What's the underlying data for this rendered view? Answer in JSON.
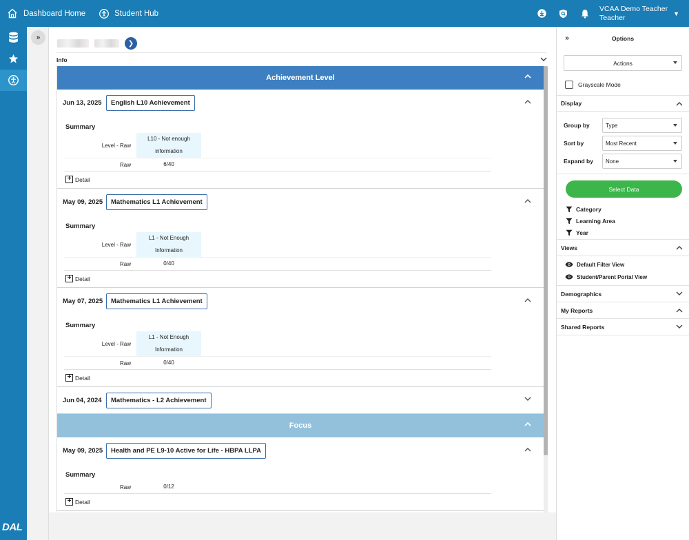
{
  "topbar": {
    "nav_home": "Dashboard Home",
    "nav_hub": "Student Hub",
    "user_name": "VCAA Demo Teacher",
    "user_role": "Teacher"
  },
  "sidebar": {
    "logo": "DAL"
  },
  "main": {
    "info_label": "Info",
    "groups": [
      {
        "label": "Achievement Level",
        "items": [
          {
            "date": "Jun 13, 2025",
            "title": "English L10 Achievement",
            "summary_label": "Summary",
            "rows": [
              {
                "label": "Level - Raw",
                "value": "L10 - Not enough information"
              },
              {
                "label": "Raw",
                "value": "6/40"
              }
            ],
            "detail_label": "Detail"
          },
          {
            "date": "May 09, 2025",
            "title": "Mathematics L1 Achievement",
            "summary_label": "Summary",
            "rows": [
              {
                "label": "Level - Raw",
                "value": "L1 - Not Enough Information"
              },
              {
                "label": "Raw",
                "value": "0/40"
              }
            ],
            "detail_label": "Detail"
          },
          {
            "date": "May 07, 2025",
            "title": "Mathematics L1 Achievement",
            "summary_label": "Summary",
            "rows": [
              {
                "label": "Level - Raw",
                "value": "L1 - Not Enough Information"
              },
              {
                "label": "Raw",
                "value": "0/40"
              }
            ],
            "detail_label": "Detail"
          },
          {
            "date": "Jun 04, 2024",
            "title": "Mathematics - L2 Achievement"
          }
        ]
      },
      {
        "label": "Focus",
        "items": [
          {
            "date": "May 09, 2025",
            "title": "Health and PE L9-10 Active for Life - HBPA LLPA",
            "summary_label": "Summary",
            "rows": [
              {
                "label": "Raw",
                "value": "0/12"
              }
            ],
            "detail_label": "Detail"
          }
        ]
      }
    ]
  },
  "options": {
    "title": "Options",
    "actions_label": "Actions",
    "grayscale_label": "Grayscale Mode",
    "display": {
      "title": "Display",
      "group_by_label": "Group by",
      "group_by_value": "Type",
      "sort_by_label": "Sort by",
      "sort_by_value": "Most Recent",
      "expand_by_label": "Expand by",
      "expand_by_value": "None"
    },
    "select_data_label": "Select Data",
    "filters": [
      "Category",
      "Learning Area",
      "Year"
    ],
    "views": {
      "title": "Views",
      "items": [
        "Default Filter View",
        "Student/Parent Portal View"
      ]
    },
    "demographics_label": "Demographics",
    "my_reports_label": "My Reports",
    "shared_reports_label": "Shared Reports"
  }
}
